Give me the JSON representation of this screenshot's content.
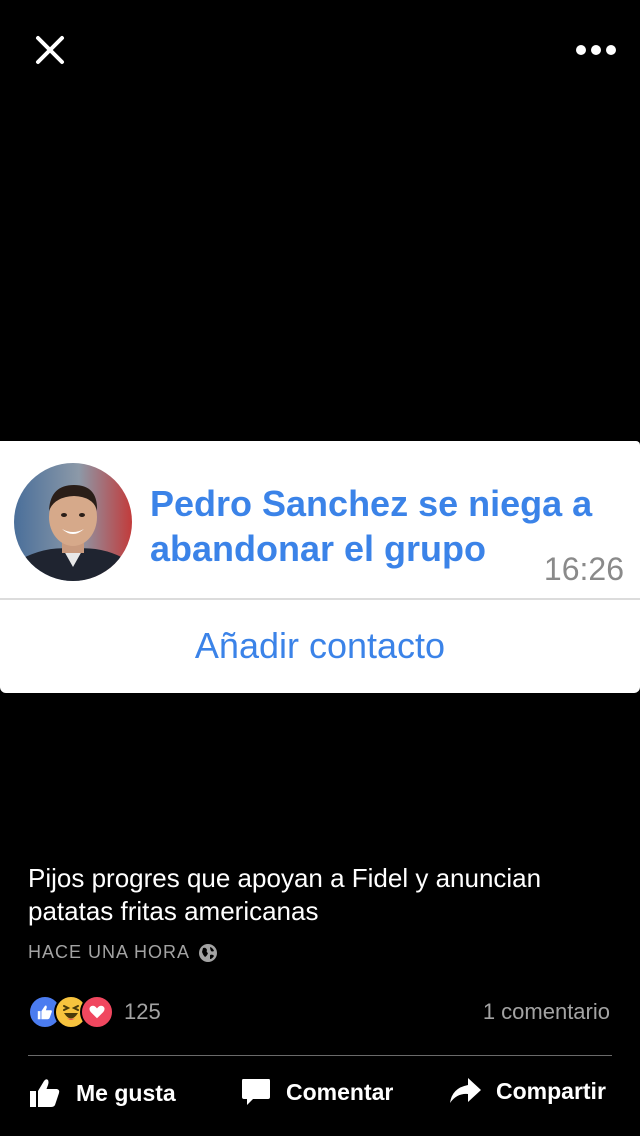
{
  "header": {
    "close_icon": "close-icon",
    "more_icon": "more-dots-icon"
  },
  "photo": {
    "message": "Pedro Sanchez se niega a abandonar el grupo",
    "time": "16:26",
    "add_contact": "Añadir contacto"
  },
  "post": {
    "caption": "Pijos progres que apoyan a Fidel y anuncian patatas fritas americanas",
    "timestamp": "HACE UNA HORA",
    "reaction_count": "125",
    "comments": "1 comentario"
  },
  "actions": {
    "like": "Me gusta",
    "comment": "Comentar",
    "share": "Compartir"
  },
  "colors": {
    "accent_blue": "#3b83e8",
    "like_blue": "#4b7cf0",
    "haha_yellow": "#f7c33e",
    "love_red": "#f0475f"
  }
}
